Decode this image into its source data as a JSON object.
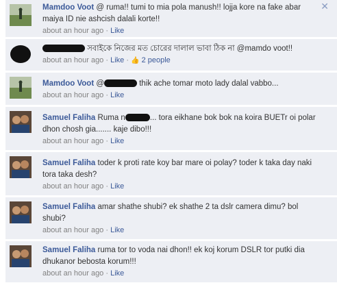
{
  "comments": [
    {
      "author": "Mamdoo Voot",
      "text": " @ ruma!! tumi to mia pola manush!! lojja kore na fake abar maiya ID nie ashcish dalali korte!!",
      "time": "about an hour ago",
      "like": "Like",
      "avatar": "landscape-avatar",
      "show_close": true
    },
    {
      "author": "",
      "text": " সবাইকে নিজের মত চোরের দালাল ভাবা ঠিক না @mamdo voot!!",
      "time": "about an hour ago",
      "like": "Like",
      "people": "2 people",
      "avatar": "redacted-avatar",
      "redacted_name": true
    },
    {
      "author": "Mamdoo Voot",
      "text_before": " @",
      "text_after": " thik ache tomar moto lady dalal vabbo...",
      "time": "about an hour ago",
      "like": "Like",
      "avatar": "landscape-avatar",
      "redacted_inline": true
    },
    {
      "author": "Samuel Faliha",
      "text_before": " Ruma n",
      "text_after": "... tora eikhane bok bok na koira BUETr oi polar dhon chosh gia....... kaje dibo!!!",
      "time": "about an hour ago",
      "like": "Like",
      "avatar": "people-avatar",
      "redacted_inline": true
    },
    {
      "author": "Samuel Faliha",
      "text": " toder k proti rate koy bar mare oi polay? toder k taka day naki tora taka desh?",
      "time": "about an hour ago",
      "like": "Like",
      "avatar": "people-avatar"
    },
    {
      "author": "Samuel Faliha",
      "text": " amar shathe shubi? ek shathe 2 ta dslr camera dimu? bol shubi?",
      "time": "about an hour ago",
      "like": "Like",
      "avatar": "people-avatar"
    },
    {
      "author": "Samuel Faliha",
      "text": " ruma tor to voda nai dhon!! ek koj korum DSLR tor putki dia dhukanor bebosta korum!!!",
      "time": "about an hour ago",
      "like": "Like",
      "avatar": "people-avatar"
    }
  ],
  "separator": " · ",
  "close_glyph": "✕",
  "thumb_glyph": "👍",
  "colors": {
    "link": "#3b5998",
    "row_bg": "#edeff4",
    "meta": "#808080"
  }
}
